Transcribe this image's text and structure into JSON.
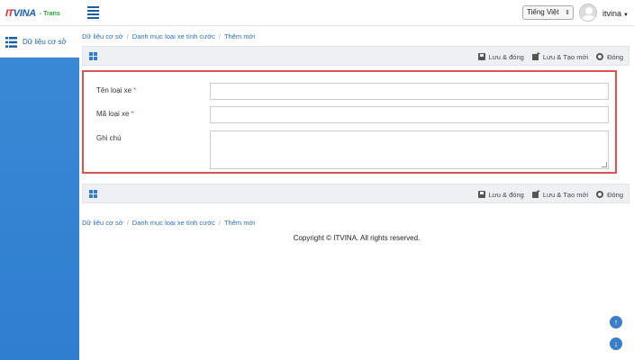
{
  "header": {
    "logo_it": "IT",
    "logo_vina": "VINA",
    "logo_trans": "- Trans",
    "language": "Tiếng Việt",
    "username": "itvina"
  },
  "sidebar": {
    "items": [
      {
        "label": "Dữ liệu cơ sở",
        "icon": "list-icon"
      }
    ]
  },
  "breadcrumb": {
    "items": [
      "Dữ liệu cơ sở",
      "Danh mục loại xe tính cước",
      "Thêm mới"
    ],
    "separator": "/"
  },
  "toolbar": {
    "save_close": "Lưu & đóng",
    "save_new": "Lưu & Tạo mới",
    "close": "Đóng"
  },
  "form": {
    "fields": [
      {
        "label": "Tên loại xe",
        "required": "*",
        "value": "",
        "type": "text"
      },
      {
        "label": "Mã loại xe",
        "required": "*",
        "value": "",
        "type": "text"
      },
      {
        "label": "Ghi chú",
        "required": "",
        "value": "",
        "type": "textarea"
      }
    ]
  },
  "footer": {
    "copyright": "Copyright © ITVINA. All rights reserved."
  },
  "colors": {
    "accent": "#2f7ed0",
    "required": "#d9534f",
    "link": "#2a6ebb"
  }
}
